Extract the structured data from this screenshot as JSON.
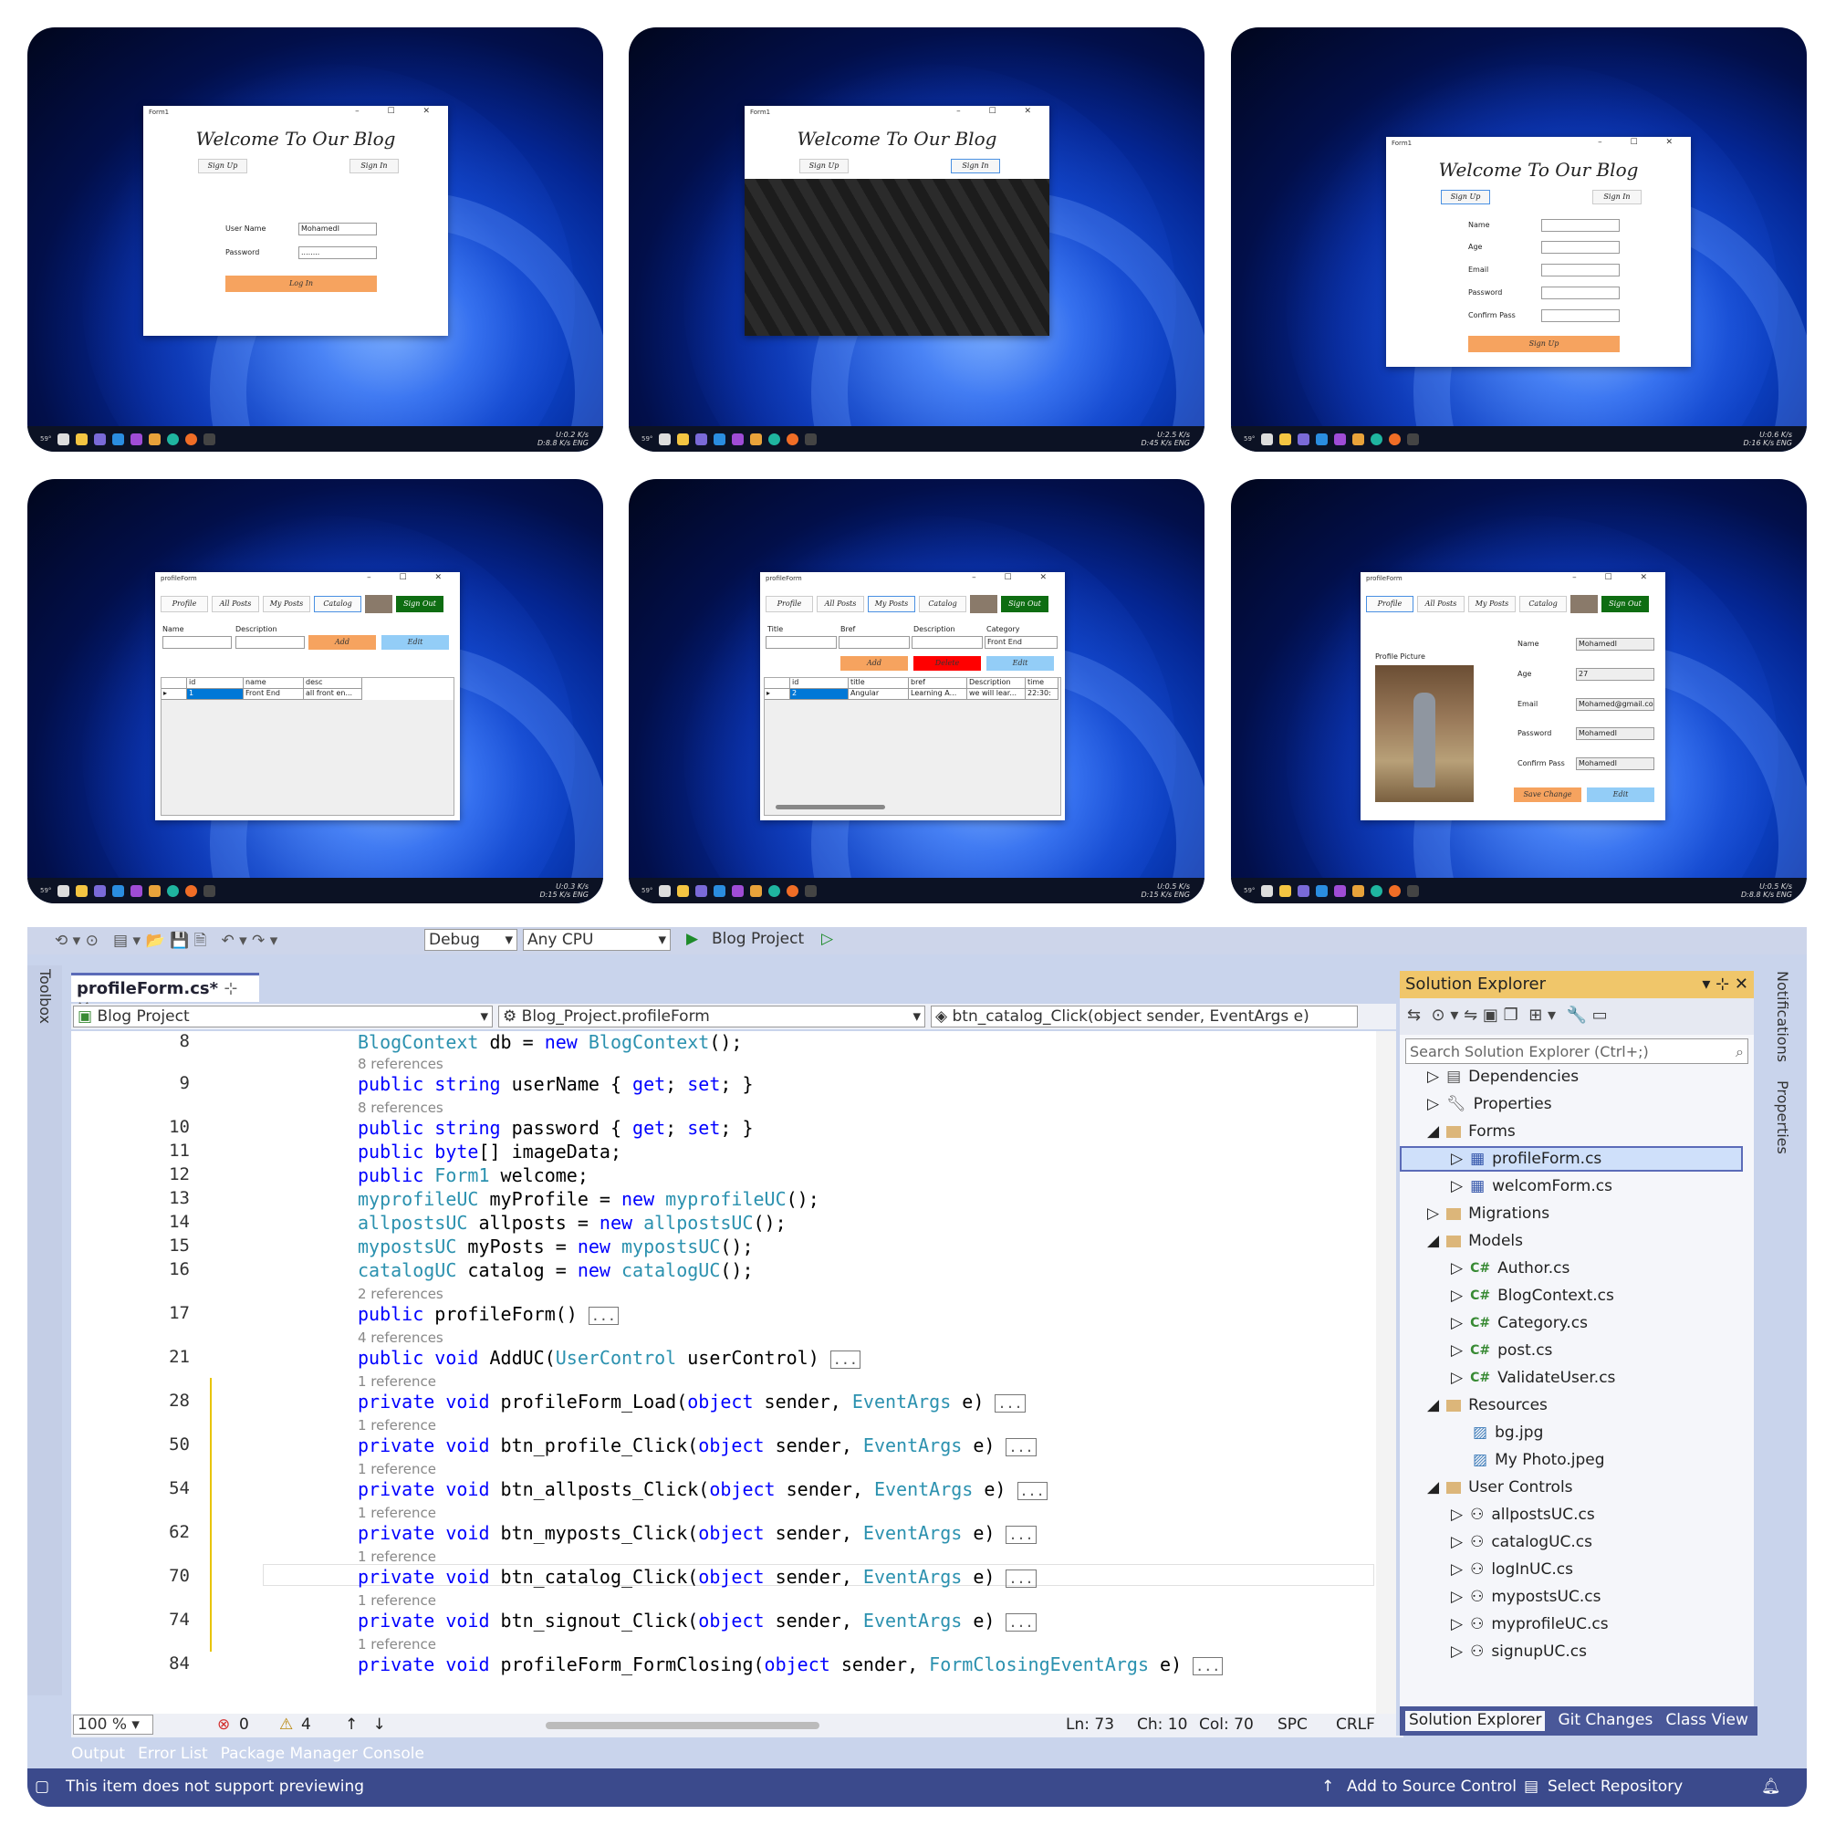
{
  "screens": {
    "login": {
      "form_title": "Form1",
      "heading": "Welcome To Our Blog",
      "tab_signup": "Sign Up",
      "tab_signin": "Sign In",
      "username_label": "User Name",
      "username_value": "MohamedI",
      "password_label": "Password",
      "password_value": "........",
      "login_button": "Log In",
      "tray_up": "U:0.2 K/s",
      "tray_down": "D:8.8 K/s",
      "lang": "ENG",
      "weather": "59°"
    },
    "splash": {
      "form_title": "Form1",
      "heading": "Welcome To Our Blog",
      "tab_signup": "Sign Up",
      "tab_signin": "Sign In",
      "tray_up": "U:2.5 K/s",
      "tray_down": "D:45 K/s",
      "lang": "ENG",
      "weather": "59°"
    },
    "signup": {
      "form_title": "Form1",
      "heading": "Welcome To Our Blog",
      "tab_signup": "Sign Up",
      "tab_signin": "Sign In",
      "labels": [
        "Name",
        "Age",
        "Email",
        "Password",
        "Confirm Pass"
      ],
      "signup_button": "Sign Up",
      "tray_up": "U:0.6 K/s",
      "tray_down": "D:16 K/s",
      "lang": "ENG",
      "weather": "59°"
    },
    "catalog": {
      "form_title": "profileForm",
      "nav": [
        "Profile",
        "All Posts",
        "My Posts",
        "Catalog"
      ],
      "signout": "Sign Out",
      "name_label": "Name",
      "desc_label": "Description",
      "add": "Add",
      "edit": "Edit",
      "columns": [
        "id",
        "name",
        "desc"
      ],
      "row": [
        "1",
        "Front End",
        "all front en..."
      ],
      "tray_up": "U:0.3 K/s",
      "tray_down": "D:15 K/s",
      "lang": "ENG",
      "weather": "59°"
    },
    "myposts": {
      "form_title": "profileForm",
      "nav": [
        "Profile",
        "All Posts",
        "My Posts",
        "Catalog"
      ],
      "signout": "Sign Out",
      "labels": [
        "Title",
        "Bref",
        "Description",
        "Category"
      ],
      "category_value": "Front End",
      "add": "Add",
      "delete": "Delete",
      "edit": "Edit",
      "columns": [
        "id",
        "title",
        "bref",
        "Description",
        "time"
      ],
      "row": [
        "2",
        "Angular",
        "Learning A...",
        "we will lear...",
        "22:30:"
      ],
      "tray_up": "U:0.5 K/s",
      "tray_down": "D:15 K/s",
      "lang": "ENG",
      "weather": "59°"
    },
    "profile": {
      "form_title": "profileForm",
      "nav": [
        "Profile",
        "All Posts",
        "My Posts",
        "Catalog"
      ],
      "signout": "Sign Out",
      "picture_label": "Profile Picture",
      "fields": [
        {
          "label": "Name",
          "value": "MohamedI"
        },
        {
          "label": "Age",
          "value": "27"
        },
        {
          "label": "Email",
          "value": "Mohamed@gmail.co"
        },
        {
          "label": "Password",
          "value": "MohamedI"
        },
        {
          "label": "Confirm Pass",
          "value": "MohamedI"
        }
      ],
      "save": "Save Change",
      "edit": "Edit",
      "tray_up": "U:0.5 K/s",
      "tray_down": "D:8.8 K/s",
      "lang": "ENG",
      "weather": "59°"
    }
  },
  "ide": {
    "config": "Debug",
    "platform": "Any CPU",
    "run_target": "Blog Project",
    "tab": "profileForm.cs*",
    "toolbox": "Toolbox",
    "nav_project": "Blog Project",
    "nav_class": "Blog_Project.profileForm",
    "nav_member": "btn_catalog_Click(object sender, EventArgs e)",
    "lines": [
      {
        "n": "8",
        "ref": "",
        "code": "BlogContext db = new BlogContext();"
      },
      {
        "n": "9",
        "ref": "8 references",
        "code": "public string userName { get; set; }"
      },
      {
        "n": "10",
        "ref": "8 references",
        "code": "public string password { get; set; }"
      },
      {
        "n": "11",
        "ref": "",
        "code": "public byte[] imageData;"
      },
      {
        "n": "12",
        "ref": "",
        "code": "public Form1 welcome;"
      },
      {
        "n": "13",
        "ref": "",
        "code": "myprofileUC myProfile = new myprofileUC();"
      },
      {
        "n": "14",
        "ref": "",
        "code": "allpostsUC allposts = new allpostsUC();"
      },
      {
        "n": "15",
        "ref": "",
        "code": "mypostsUC myPosts = new mypostsUC();"
      },
      {
        "n": "16",
        "ref": "",
        "code": "catalogUC catalog = new catalogUC();"
      },
      {
        "n": "17",
        "ref": "2 references",
        "code": "public profileForm()"
      },
      {
        "n": "21",
        "ref": "4 references",
        "code": "public void AddUC(UserControl userControl)"
      },
      {
        "n": "28",
        "ref": "1 reference",
        "code": "private void profileForm_Load(object sender, EventArgs e)"
      },
      {
        "n": "50",
        "ref": "1 reference",
        "code": "private void btn_profile_Click(object sender, EventArgs e)"
      },
      {
        "n": "54",
        "ref": "1 reference",
        "code": "private void btn_allposts_Click(object sender, EventArgs e)"
      },
      {
        "n": "62",
        "ref": "1 reference",
        "code": "private void btn_myposts_Click(object sender, EventArgs e)"
      },
      {
        "n": "70",
        "ref": "1 reference",
        "code": "private void btn_catalog_Click(object sender, EventArgs e)"
      },
      {
        "n": "74",
        "ref": "1 reference",
        "code": "private void btn_signout_Click(object sender, EventArgs e)"
      },
      {
        "n": "84",
        "ref": "1 reference",
        "code": "private void profileForm_FormClosing(object sender, FormClosingEventArgs e)"
      }
    ],
    "status": {
      "zoom": "100 %",
      "errors": "0",
      "warnings": "4",
      "ln": "Ln: 73",
      "ch": "Ch: 10",
      "col": "Col: 70",
      "spc": "SPC",
      "crlf": "CRLF"
    },
    "bottom_tabs": [
      "Output",
      "Error List",
      "Package Manager Console"
    ],
    "statusbar": {
      "message": "This item does not support previewing",
      "source_control": "Add to Source Control",
      "repo": "Select Repository"
    },
    "solution": {
      "title": "Solution Explorer",
      "search": "Search Solution Explorer (Ctrl+;)",
      "items": [
        {
          "label": "Dependencies",
          "kind": "deps"
        },
        {
          "label": "Properties",
          "kind": "props"
        },
        {
          "label": "Forms",
          "kind": "folder"
        },
        {
          "label": "profileForm.cs",
          "kind": "form"
        },
        {
          "label": "welcomForm.cs",
          "kind": "form"
        },
        {
          "label": "Migrations",
          "kind": "folder"
        },
        {
          "label": "Models",
          "kind": "folder"
        },
        {
          "label": "Author.cs",
          "kind": "cs"
        },
        {
          "label": "BlogContext.cs",
          "kind": "cs"
        },
        {
          "label": "Category.cs",
          "kind": "cs"
        },
        {
          "label": "post.cs",
          "kind": "cs"
        },
        {
          "label": "ValidateUser.cs",
          "kind": "cs"
        },
        {
          "label": "Resources",
          "kind": "folder"
        },
        {
          "label": "bg.jpg",
          "kind": "image"
        },
        {
          "label": "My Photo.jpeg",
          "kind": "image"
        },
        {
          "label": "User Controls",
          "kind": "folder"
        },
        {
          "label": "allpostsUC.cs",
          "kind": "uc"
        },
        {
          "label": "catalogUC.cs",
          "kind": "uc"
        },
        {
          "label": "logInUC.cs",
          "kind": "uc"
        },
        {
          "label": "mypostsUC.cs",
          "kind": "uc"
        },
        {
          "label": "myprofileUC.cs",
          "kind": "uc"
        },
        {
          "label": "signupUC.cs",
          "kind": "uc"
        }
      ],
      "tabs": [
        "Solution Explorer",
        "Git Changes",
        "Class View"
      ],
      "side_tabs": [
        "Notifications",
        "Properties"
      ]
    }
  }
}
